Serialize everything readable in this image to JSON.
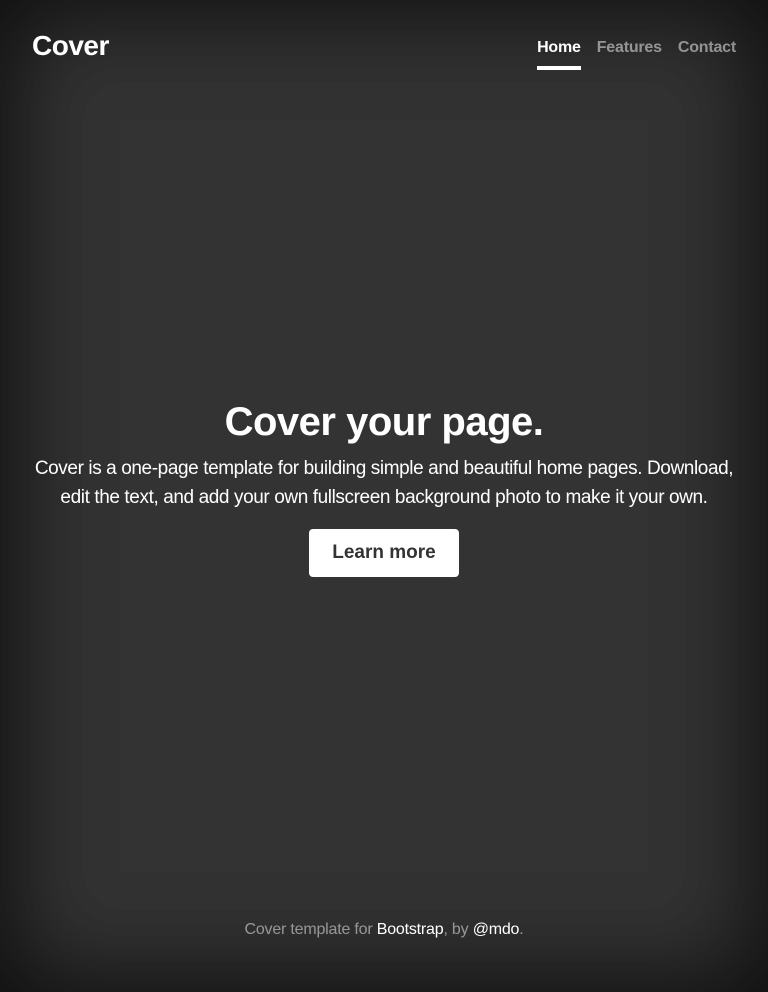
{
  "masthead": {
    "brand": "Cover",
    "nav": [
      {
        "label": "Home",
        "active": true
      },
      {
        "label": "Features",
        "active": false
      },
      {
        "label": "Contact",
        "active": false
      }
    ]
  },
  "cover": {
    "heading": "Cover your page.",
    "lead": "Cover is a one-page template for building simple and beautiful home pages. Download, edit the text, and add your own fullscreen background photo to make it your own.",
    "button_label": "Learn more"
  },
  "footer": {
    "prefix": "Cover template for ",
    "link1": "Bootstrap",
    "middle": ", by ",
    "link2": "@mdo",
    "suffix": "."
  },
  "colors": {
    "background": "#333333",
    "text": "#ffffff",
    "muted": "rgba(255,255,255,0.5)"
  }
}
